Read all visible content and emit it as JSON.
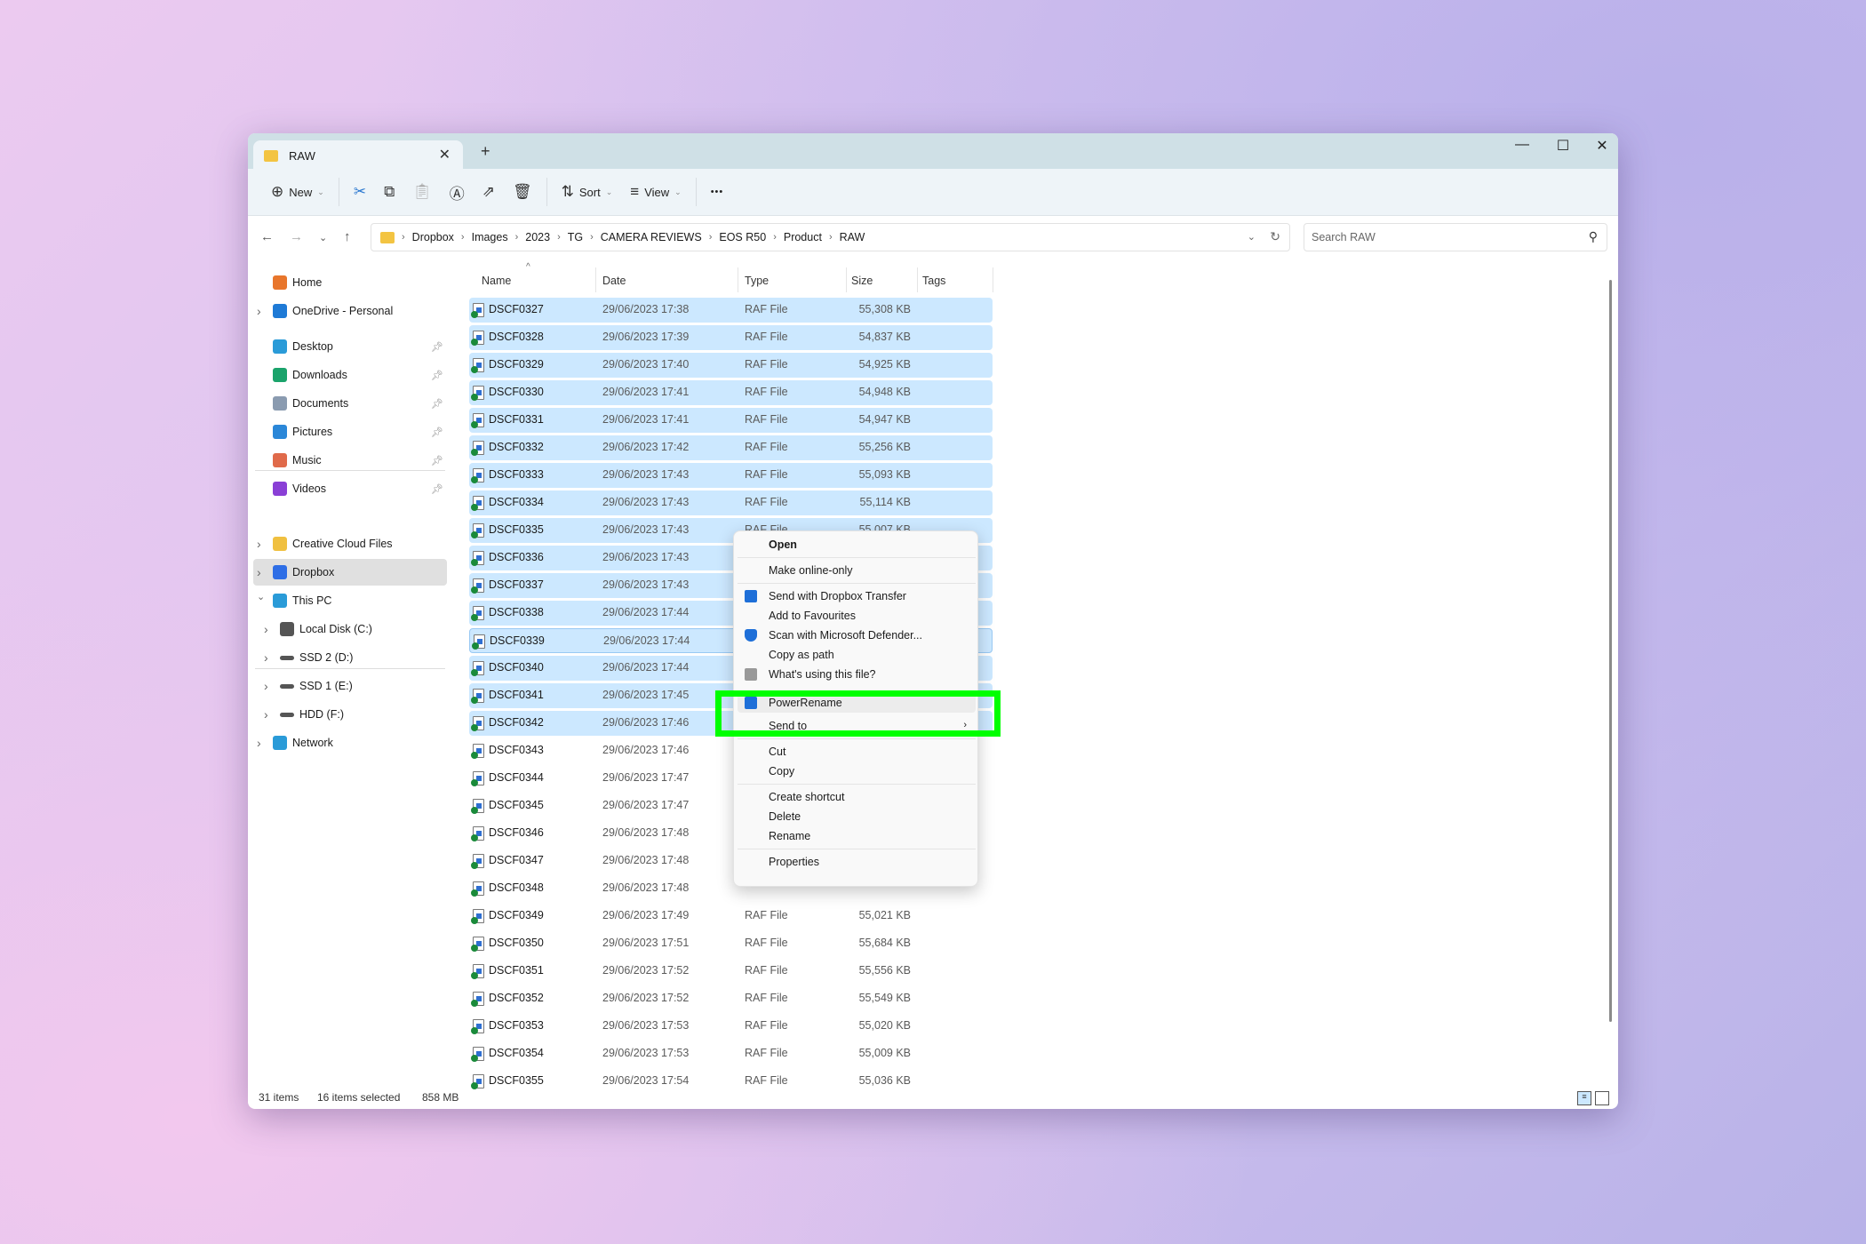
{
  "window": {
    "tab_title": "RAW",
    "new_tab": "+",
    "minimize": "—",
    "maximize": "☐",
    "close": "✕"
  },
  "toolbar": {
    "new_label": "New",
    "sort_label": "Sort",
    "view_label": "View",
    "more": "•••"
  },
  "address": {
    "crumbs": [
      "Dropbox",
      "Images",
      "2023",
      "TG",
      "CAMERA REVIEWS",
      "EOS R50",
      "Product",
      "RAW"
    ],
    "search_placeholder": "Search RAW"
  },
  "sidebar": {
    "items": [
      {
        "label": "Home",
        "icon": "home-icon",
        "color": "#e8762c"
      },
      {
        "label": "OneDrive - Personal",
        "icon": "onedrive-icon",
        "color": "#1e7ad6",
        "expand": true
      },
      {
        "label": "Desktop",
        "icon": "desktop-icon",
        "color": "#2a9bd8",
        "pin": true
      },
      {
        "label": "Downloads",
        "icon": "downloads-icon",
        "color": "#1aa36b",
        "pin": true
      },
      {
        "label": "Documents",
        "icon": "documents-icon",
        "color": "#8a9bb0",
        "pin": true
      },
      {
        "label": "Pictures",
        "icon": "pictures-icon",
        "color": "#2b87d8",
        "pin": true
      },
      {
        "label": "Music",
        "icon": "music-icon",
        "color": "#e06a4a",
        "pin": true
      },
      {
        "label": "Videos",
        "icon": "videos-icon",
        "color": "#8a3fd6",
        "pin": true
      },
      {
        "label": "Creative Cloud Files",
        "icon": "creative-cloud-icon",
        "color": "#f0c040",
        "expand": true
      },
      {
        "label": "Dropbox",
        "icon": "dropbox-icon",
        "color": "#2e6ee6",
        "expand": true,
        "active": true
      },
      {
        "label": "This PC",
        "icon": "pc-icon",
        "color": "#2a9bd8",
        "expanded": true
      },
      {
        "label": "Local Disk (C:)",
        "icon": "local-disk-icon",
        "color": "#555",
        "expand": true,
        "indent": true
      },
      {
        "label": "SSD 2 (D:)",
        "icon": "drive-icon",
        "color": "#555",
        "expand": true,
        "indent": true
      },
      {
        "label": "SSD 1 (E:)",
        "icon": "drive-icon",
        "color": "#555",
        "expand": true,
        "indent": true
      },
      {
        "label": "HDD (F:)",
        "icon": "drive-icon",
        "color": "#555",
        "expand": true,
        "indent": true
      },
      {
        "label": "Network",
        "icon": "network-icon",
        "color": "#2a9bd8",
        "expand": true
      }
    ]
  },
  "columns": [
    "Name",
    "Date",
    "Type",
    "Size",
    "Tags"
  ],
  "files": [
    [
      "DSCF0327",
      "29/06/2023 17:38",
      "RAF File",
      "55,308 KB"
    ],
    [
      "DSCF0328",
      "29/06/2023 17:39",
      "RAF File",
      "54,837 KB"
    ],
    [
      "DSCF0329",
      "29/06/2023 17:40",
      "RAF File",
      "54,925 KB"
    ],
    [
      "DSCF0330",
      "29/06/2023 17:41",
      "RAF File",
      "54,948 KB"
    ],
    [
      "DSCF0331",
      "29/06/2023 17:41",
      "RAF File",
      "54,947 KB"
    ],
    [
      "DSCF0332",
      "29/06/2023 17:42",
      "RAF File",
      "55,256 KB"
    ],
    [
      "DSCF0333",
      "29/06/2023 17:43",
      "RAF File",
      "55,093 KB"
    ],
    [
      "DSCF0334",
      "29/06/2023 17:43",
      "RAF File",
      "55,114 KB"
    ],
    [
      "DSCF0335",
      "29/06/2023 17:43",
      "RAF File",
      "55,007 KB"
    ],
    [
      "DSCF0336",
      "29/06/2023 17:43",
      "",
      ""
    ],
    [
      "DSCF0337",
      "29/06/2023 17:43",
      "",
      ""
    ],
    [
      "DSCF0338",
      "29/06/2023 17:44",
      "",
      ""
    ],
    [
      "DSCF0339",
      "29/06/2023 17:44",
      "",
      ""
    ],
    [
      "DSCF0340",
      "29/06/2023 17:44",
      "",
      ""
    ],
    [
      "DSCF0341",
      "29/06/2023 17:45",
      "",
      ""
    ],
    [
      "DSCF0342",
      "29/06/2023 17:46",
      "",
      ""
    ],
    [
      "DSCF0343",
      "29/06/2023 17:46",
      "",
      ""
    ],
    [
      "DSCF0344",
      "29/06/2023 17:47",
      "",
      ""
    ],
    [
      "DSCF0345",
      "29/06/2023 17:47",
      "",
      ""
    ],
    [
      "DSCF0346",
      "29/06/2023 17:48",
      "",
      ""
    ],
    [
      "DSCF0347",
      "29/06/2023 17:48",
      "",
      ""
    ],
    [
      "DSCF0348",
      "29/06/2023 17:48",
      "",
      ""
    ],
    [
      "DSCF0349",
      "29/06/2023 17:49",
      "RAF File",
      "55,021 KB"
    ],
    [
      "DSCF0350",
      "29/06/2023 17:51",
      "RAF File",
      "55,684 KB"
    ],
    [
      "DSCF0351",
      "29/06/2023 17:52",
      "RAF File",
      "55,556 KB"
    ],
    [
      "DSCF0352",
      "29/06/2023 17:52",
      "RAF File",
      "55,549 KB"
    ],
    [
      "DSCF0353",
      "29/06/2023 17:53",
      "RAF File",
      "55,020 KB"
    ],
    [
      "DSCF0354",
      "29/06/2023 17:53",
      "RAF File",
      "55,009 KB"
    ],
    [
      "DSCF0355",
      "29/06/2023 17:54",
      "RAF File",
      "55,036 KB"
    ]
  ],
  "selected_count_rows": 16,
  "context_menu": {
    "items": [
      {
        "label": "Open",
        "bold": true
      },
      {
        "sep": true
      },
      {
        "label": "Make online-only"
      },
      {
        "sep": true
      },
      {
        "label": "Send with Dropbox Transfer",
        "icon": "dropbox-icon"
      },
      {
        "label": "Add to Favourites"
      },
      {
        "label": "Scan with Microsoft Defender...",
        "icon": "shield-icon"
      },
      {
        "label": "Copy as path"
      },
      {
        "label": "What's using this file?",
        "icon": "lock-icon"
      },
      {
        "label": "PowerRename",
        "icon": "powerrename-icon",
        "highlight": true
      },
      {
        "label": "Send to",
        "submenu": true
      },
      {
        "sep": true
      },
      {
        "label": "Cut"
      },
      {
        "label": "Copy"
      },
      {
        "sep": true
      },
      {
        "label": "Create shortcut"
      },
      {
        "label": "Delete"
      },
      {
        "label": "Rename"
      },
      {
        "sep": true
      },
      {
        "label": "Properties"
      }
    ]
  },
  "status": {
    "items": "31 items",
    "selected": "16 items selected",
    "size": "858 MB"
  },
  "colors": {
    "selection": "#cce8ff",
    "highlight_box": "#00ff00",
    "titlebar": "#cfe0e6"
  }
}
